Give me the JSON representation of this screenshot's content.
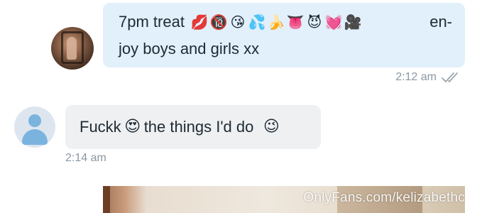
{
  "messages": [
    {
      "line1_text": "7pm treat",
      "emojis": [
        "💋",
        "🔞",
        "😘",
        "💦",
        "🍌",
        "👅",
        "😈",
        "💓",
        "🎥"
      ],
      "line1_trail": "en-",
      "line2_text": "joy boys and girls xx",
      "time": "2:12 am",
      "read_status_icon": "double-check-icon",
      "avatar": "user-photo-avatar"
    },
    {
      "text_before": "Fuckk",
      "emoji_mid": "😍",
      "text_after": "the things I'd do",
      "emoji_end": "😉",
      "time": "2:14 am",
      "avatar": "default-user-avatar"
    }
  ],
  "watermark": "OnlyFans.com/kelizabethc",
  "colors": {
    "incoming_highlight_bg": "#e1f0fb",
    "incoming_bg": "#eef0f2",
    "meta_text": "#8a97a3",
    "default_avatar": "#7bb3df"
  }
}
